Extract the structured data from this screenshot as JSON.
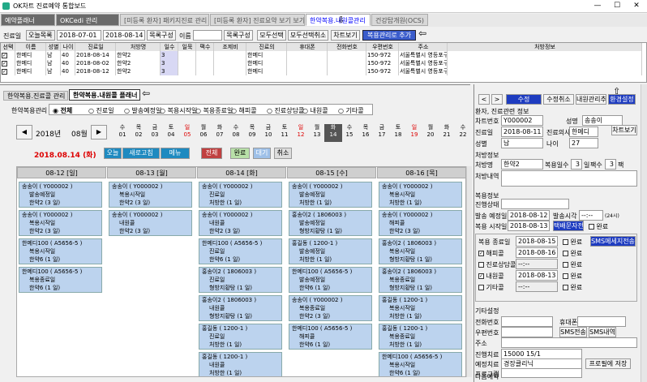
{
  "window": {
    "title": "OK차트 진료예약 통합보드",
    "min": "—",
    "max": "☐",
    "close": "✕"
  },
  "tabs": [
    "예약플래너",
    "OKCedi 관리",
    "[미등록 환자] 패키지진료 관리 보기",
    "[미등록 환자] 진료요약 보기 보기",
    "한약복용.내원콜관리",
    "건강탑개원(OCS)"
  ],
  "toolbar": {
    "label": "진료일",
    "status_select": "오늘목록",
    "date_from": "2018-07-01",
    "date_to": "2018-08-14",
    "compose": "목록구성",
    "name_label": "이름",
    "name_value": "",
    "list_compose": "목록구성",
    "select_all": "모두선택",
    "deselect_all": "모두선택취소",
    "chart_view": "차트보기",
    "add_herbal": "복용관리로 추가"
  },
  "list": {
    "headers": [
      "선택",
      "이름",
      "성별",
      "나이",
      "진료일",
      "처방명",
      "일수",
      "일묵",
      "팩수",
      "조제비",
      "진료의",
      "휴대폰",
      "전화번호",
      "우편번호",
      "주소",
      "처방정보"
    ],
    "rows": [
      [
        "✓",
        "한메디",
        "남",
        "40",
        "2018-08-14",
        "한약2",
        "3",
        "",
        "",
        "",
        "한메디",
        "",
        "",
        "150-972",
        "서울특별시 영등포구 경인로",
        ""
      ],
      [
        "✓",
        "한메디",
        "남",
        "40",
        "2018-08-02",
        "한약2",
        "3",
        "",
        "",
        "",
        "한메디",
        "",
        "",
        "150-972",
        "서울특별시 영등포구 경인로",
        ""
      ],
      [
        "✓",
        "한메디",
        "남",
        "40",
        "2018-08-12",
        "한약2",
        "3",
        "",
        "",
        "",
        "한메디",
        "",
        "",
        "150-972",
        "서울특별시 영등포구 경인로",
        ""
      ]
    ]
  },
  "subtabs": [
    "한약복용.진료콜 관리",
    "한약복용.내원콜 플래너"
  ],
  "filter": {
    "label": "한약복용관리",
    "options": [
      "전체",
      "진료일",
      "발송예정일",
      "복용시작일",
      "복용종료일",
      "해피콜",
      "진료상담콜",
      "내원콜",
      "기타콜"
    ],
    "selected": 0
  },
  "calendar": {
    "year": "2018년",
    "month": "08월",
    "weekdays": [
      "수",
      "목",
      "금",
      "토",
      "일",
      "월",
      "화",
      "수",
      "목",
      "금",
      "토",
      "일",
      "월",
      "화",
      "수",
      "목",
      "금",
      "토",
      "일",
      "월",
      "화",
      "수"
    ],
    "days": [
      "01",
      "02",
      "03",
      "04",
      "05",
      "06",
      "07",
      "08",
      "09",
      "10",
      "11",
      "12",
      "13",
      "14",
      "15",
      "16",
      "17",
      "18",
      "19",
      "20",
      "21",
      "22"
    ],
    "selected_index": 13
  },
  "today_label": "2018.08.14 (화)",
  "view_buttons": {
    "today": "오늘",
    "refresh": "새로고침",
    "menu": "메뉴",
    "all": "전체",
    "done": "완료",
    "wait": "대기",
    "cancel": "취소"
  },
  "days": [
    {
      "header": "08-12 [일]",
      "cards": [
        {
          "name": "송송이 ( Y000002 )",
          "lines": [
            "발송예정일",
            "한약2 (3 일)"
          ]
        },
        {
          "name": "송송이 ( Y000002 )",
          "lines": [
            "복용시작일",
            "한약2 (3 일)"
          ]
        },
        {
          "name": "한메디100 ( A5656-5 )",
          "lines": [
            "복용시작일",
            "한약6 (1 일)"
          ]
        },
        {
          "name": "한메디100 ( A5656-5 )",
          "lines": [
            "복용종료일",
            "한약6 (1 일)"
          ]
        }
      ]
    },
    {
      "header": "08-13 [월]",
      "cards": [
        {
          "name": "송송이 ( Y000002 )",
          "lines": [
            "복용시작일",
            "한약2 (3 일)"
          ]
        },
        {
          "name": "송송이 ( Y000002 )",
          "lines": [
            "내원콜",
            "한약2 (3 일)"
          ]
        }
      ]
    },
    {
      "header": "08-14 [화]",
      "cards": [
        {
          "name": "송송이 ( Y000002 )",
          "lines": [
            "진료일",
            "처방한 (1 일)"
          ]
        },
        {
          "name": "송송이 ( Y000002 )",
          "lines": [
            "내원콜",
            "한약2 (3 일)"
          ]
        },
        {
          "name": "한메디100 ( A5656-5 )",
          "lines": [
            "진료일",
            "한약6 (1 일)"
          ]
        },
        {
          "name": "홍송이2 ( 1806003 )",
          "lines": [
            "진료일",
            "형방지황탕 (1 일)"
          ]
        },
        {
          "name": "홍송이2 ( 1806003 )",
          "lines": [
            "내원콜",
            "형방지황탕 (1 일)"
          ]
        },
        {
          "name": "홍길동 ( 1200-1 )",
          "lines": [
            "진료일",
            "처방한 (1 일)"
          ]
        },
        {
          "name": "홍길동 ( 1200-1 )",
          "lines": [
            "내원콜",
            "처방한 (1 일)"
          ]
        },
        {
          "name": "한메디100 ( A5656-5 )",
          "lines": [
            "해피콜"
          ]
        }
      ]
    },
    {
      "header": "08-15 [수]",
      "cards": [
        {
          "name": "송송이 ( Y000002 )",
          "lines": [
            "발송예정일",
            "처방한 (1 일)"
          ]
        },
        {
          "name": "홍송이2 ( 1806003 )",
          "lines": [
            "발송예정일",
            "형방지황탕 (1 일)"
          ]
        },
        {
          "name": "홍길동 ( 1200-1 )",
          "lines": [
            "발송예정일",
            "처방한 (1 일)"
          ]
        },
        {
          "name": "한메디100 ( A5656-5 )",
          "lines": [
            "발송예정일",
            "한약6 (1 일)"
          ]
        },
        {
          "name": "송송이 ( Y000002 )",
          "lines": [
            "복용종료일",
            "한약2 (3 일)"
          ]
        },
        {
          "name": "한메디100 ( A5656-5 )",
          "lines": [
            "해피콜",
            "한약6 (1 일)"
          ]
        }
      ]
    },
    {
      "header": "08-16 [목]",
      "cards": [
        {
          "name": "송송이 ( Y000002 )",
          "lines": [
            "복용시작일",
            "처방한 (1 일)"
          ]
        },
        {
          "name": "송송이 ( Y000002 )",
          "lines": [
            "해피콜",
            "한약2 (3 일)"
          ]
        },
        {
          "name": "홍송이2 ( 1806003 )",
          "lines": [
            "복용시작일",
            "형방지황탕 (1 일)"
          ]
        },
        {
          "name": "홍송이2 ( 1806003 )",
          "lines": [
            "복용종료일",
            "형방지황탕 (1 일)"
          ]
        },
        {
          "name": "홍길동 ( 1200-1 )",
          "lines": [
            "복용시작일",
            "처방한 (1 일)"
          ]
        },
        {
          "name": "홍길동 ( 1200-1 )",
          "lines": [
            "복용종료일",
            "처방한 (1 일)"
          ]
        },
        {
          "name": "한메디100 ( A5656-5 )",
          "lines": [
            "복용시작일",
            "한약6 (1 일)"
          ]
        }
      ]
    }
  ],
  "right": {
    "nav_prev": "<",
    "nav_next": ">",
    "edit": "수정",
    "cancel_edit": "수정취소",
    "add_visit": "내원관리추가",
    "env": "환경설정",
    "section": "환자, 진료관련 정보",
    "chart_no_label": "차트번호",
    "chart_no": "Y000002",
    "name_label": "성명",
    "name": "송송이",
    "visit_label": "진료일",
    "visit": "2018-08-11",
    "doctor_label": "진료의사",
    "doctor": "한메디",
    "sex_label": "성별",
    "sex": "남",
    "age_label": "나이",
    "age": "27",
    "rx_section": "처방정보",
    "rx_label": "처방명",
    "rx": "한약2",
    "dose_days_label": "복용일수",
    "dose_days": "3",
    "day_unit": "일",
    "pack_label": "팩수",
    "packs": "3",
    "pack_unit": "팩",
    "rx_content_label": "처방내역",
    "intake_section": "복용정보",
    "progress_label": "진행상태",
    "send_label": "발송 예정일",
    "send_date": "2018-08-12",
    "send_time_label": "발송시각",
    "send_time": "--:--",
    "am_pm": "(24시)",
    "start_label": "복용 시작일",
    "start_date": "2018-08-13",
    "sms_doc": "택배문자전송",
    "done": "완료",
    "end_label": "복용 종료일",
    "end_date": "2018-08-15",
    "sms_send": "SMS메세지전송",
    "happy_label": "해피콜",
    "happy_date": "2018-08-16",
    "consult_label": "진료상담콜",
    "consult_date": "--:--",
    "visitcall_label": "내원콜",
    "visitcall_date": "2018-08-13",
    "etc_label": "기타콜",
    "etc_date": "--:--",
    "etc_section": "기타설정",
    "phone_label": "전화번호",
    "mobile_label": "휴대폰",
    "zip_label": "우편번호",
    "sms_send_btn": "SMS전송",
    "sms_list": "SMS내역",
    "addr_label": "주소",
    "fee_label": "진행치료",
    "fee": "15000 15/1",
    "reserve_label": "예정치료",
    "reserve": "경장클리닉",
    "reserve_btn": "프로필에 저장",
    "program_label": "프로그램",
    "next_label": "다음예약"
  }
}
